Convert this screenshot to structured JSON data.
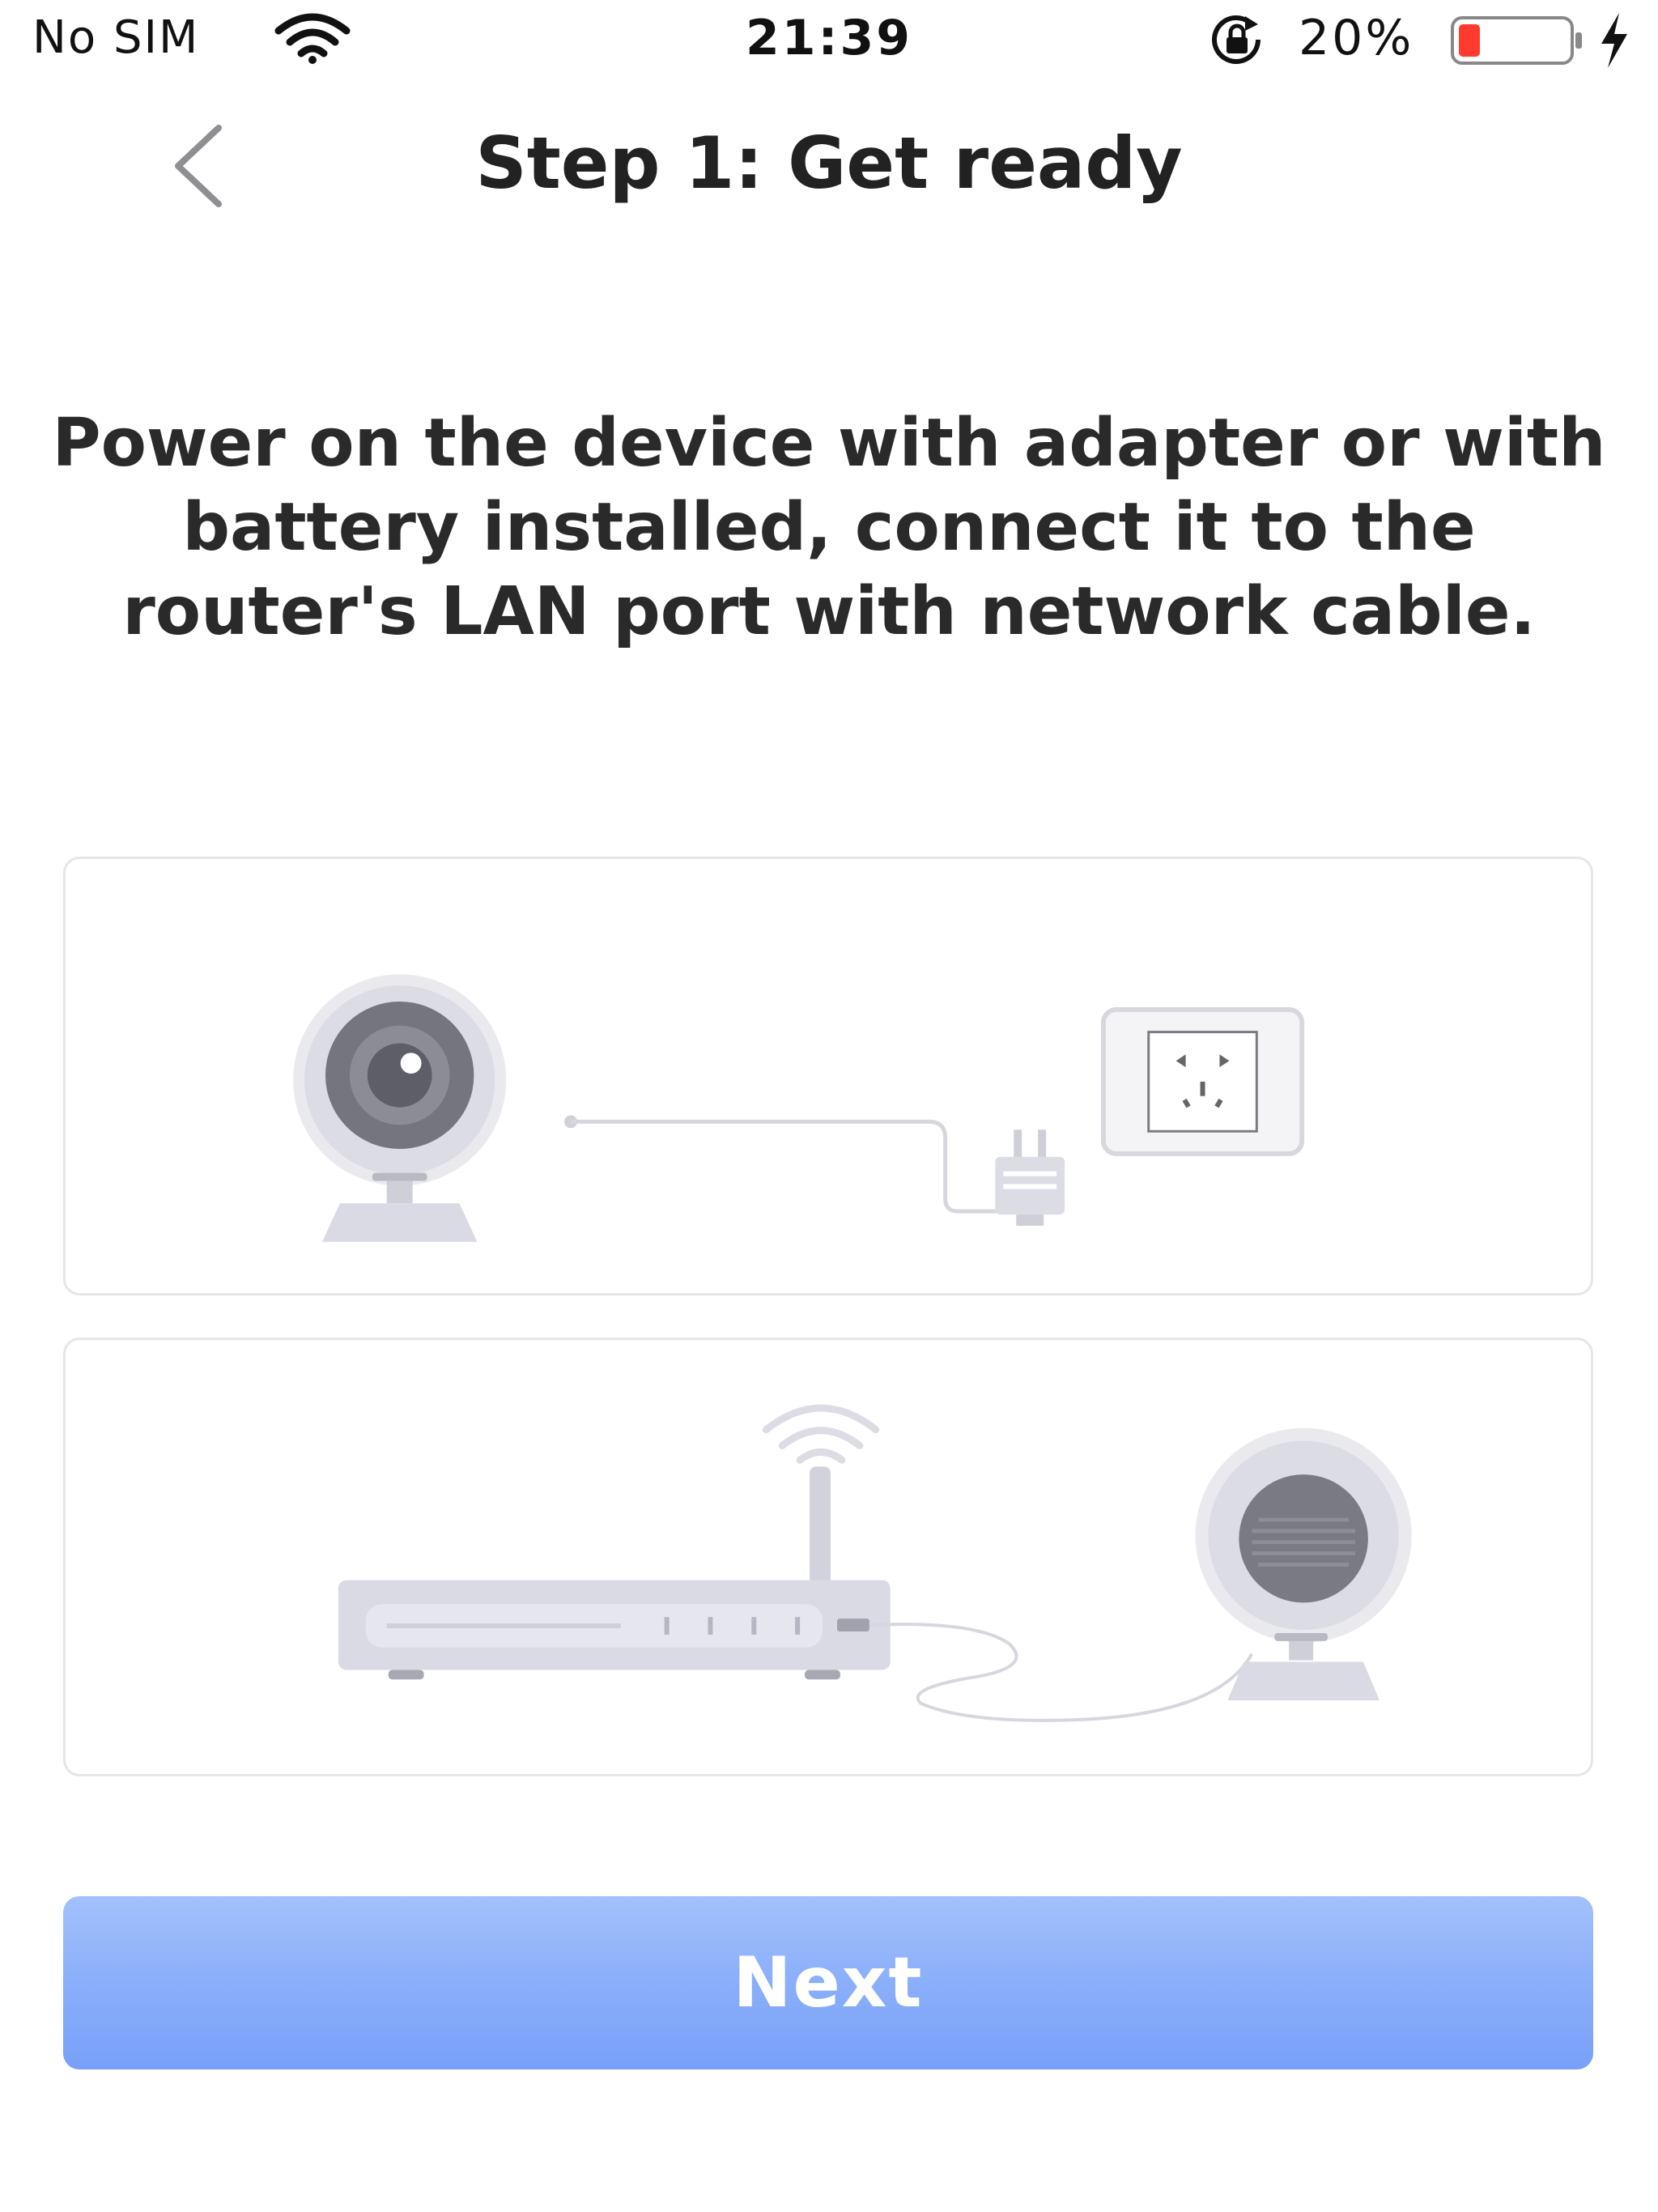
{
  "status_bar": {
    "carrier": "No SIM",
    "time": "21:39",
    "battery_percent": "20%",
    "icons": [
      "wifi-icon",
      "lock-rotation-icon",
      "battery-icon",
      "charging-icon"
    ],
    "battery_level_fraction": 0.2,
    "battery_fill_color": "#ff3b30"
  },
  "header": {
    "back_icon": "chevron-left-icon",
    "title": "Step 1: Get ready"
  },
  "instruction": {
    "text": "Power on  the device with adapter or with battery installed, connect it to the router's LAN port with network cable."
  },
  "illustrations": [
    {
      "name": "camera-power-adapter-illustration",
      "icons": [
        "camera-icon",
        "power-adapter-icon",
        "wall-socket-icon"
      ]
    },
    {
      "name": "router-camera-cable-illustration",
      "icons": [
        "router-icon",
        "camera-icon",
        "network-cable-icon"
      ]
    }
  ],
  "actions": {
    "next_label": "Next"
  },
  "colors": {
    "accent": "#77a0f8",
    "accent_light": "#a3c1fb",
    "illustration_gray": "#d9dae3",
    "illustration_dark": "#6e6e78",
    "card_border": "#e6e6ea"
  }
}
